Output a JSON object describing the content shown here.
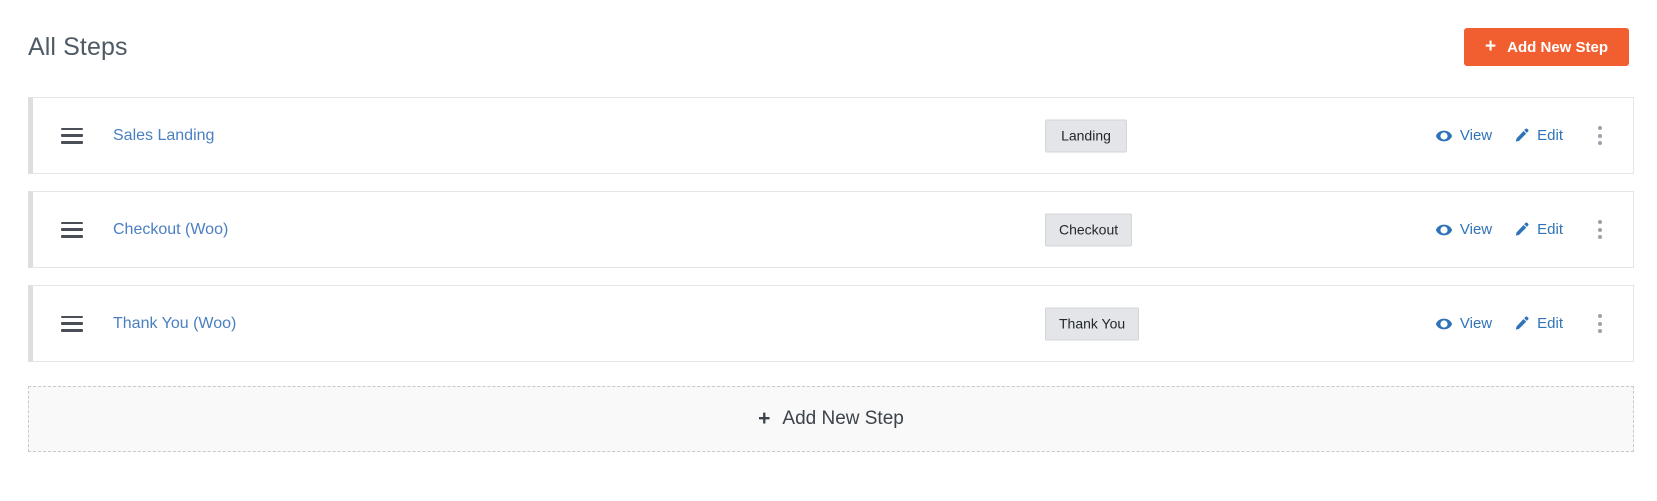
{
  "header": {
    "title": "All Steps",
    "add_button": {
      "label": "Add New Step",
      "icon": "plus-icon",
      "plus": "+",
      "color": "#f15f31"
    }
  },
  "steps": {
    "columns": [
      "name",
      "type",
      "actions"
    ],
    "rows": [
      {
        "drag_handle_icon": "drag-handle-icon",
        "name": "Sales Landing",
        "type_badge": "Landing",
        "view_label": "View",
        "view_icon": "eye-icon",
        "edit_label": "Edit",
        "edit_icon": "pencil-icon",
        "menu_icon": "kebab-menu-icon"
      },
      {
        "drag_handle_icon": "drag-handle-icon",
        "name": "Checkout (Woo)",
        "type_badge": "Checkout",
        "view_label": "View",
        "view_icon": "eye-icon",
        "edit_label": "Edit",
        "edit_icon": "pencil-icon",
        "menu_icon": "kebab-menu-icon"
      },
      {
        "drag_handle_icon": "drag-handle-icon",
        "name": "Thank You (Woo)",
        "type_badge": "Thank You",
        "view_label": "View",
        "view_icon": "eye-icon",
        "edit_label": "Edit",
        "edit_icon": "pencil-icon",
        "menu_icon": "kebab-menu-icon"
      }
    ]
  },
  "footer": {
    "add_step": {
      "label": "Add New Step",
      "icon": "plus-icon",
      "plus": "+"
    }
  },
  "colors": {
    "accent": "#f15f31",
    "link": "#2e73b8",
    "step_link": "#4a7fc1",
    "badge_bg": "#e3e5e8",
    "title": "#4e5a65"
  }
}
